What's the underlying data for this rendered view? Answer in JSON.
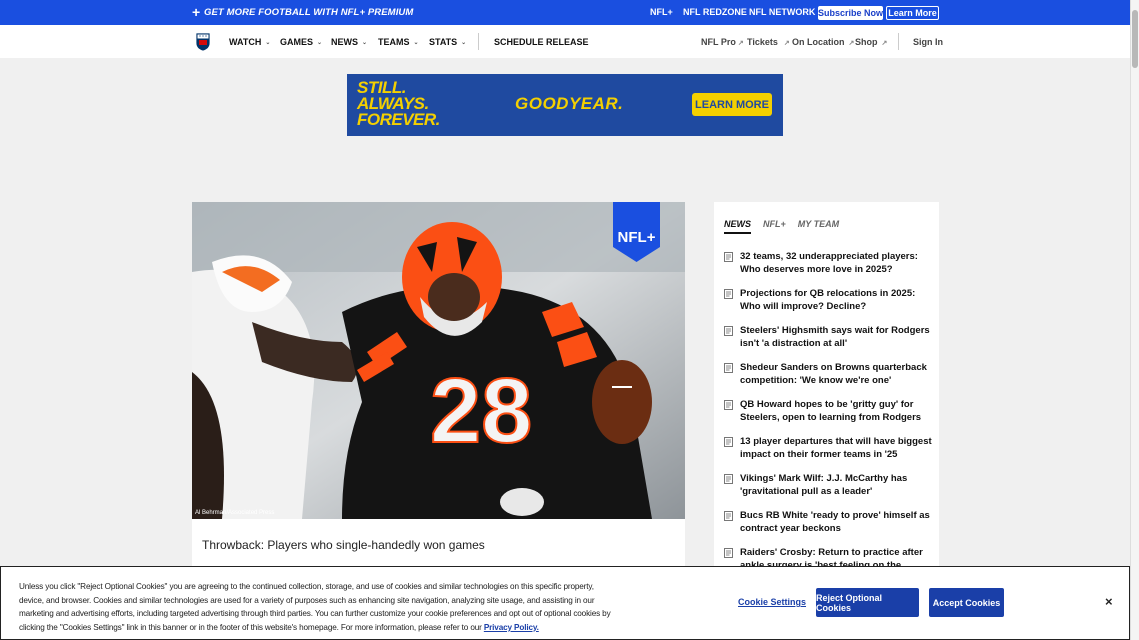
{
  "promo": {
    "plus_icon": "+",
    "text": "GET MORE FOOTBALL WITH NFL+ PREMIUM",
    "links": [
      "NFL+",
      "NFL REDZONE",
      "NFL NETWORK"
    ],
    "subscribe_label": "Subscribe Now",
    "learn_label": "Learn More",
    "color": "#1a4fe0"
  },
  "nav": {
    "logo_icon": "nfl-shield-icon",
    "items": [
      "WATCH",
      "GAMES",
      "NEWS",
      "TEAMS",
      "STATS"
    ],
    "caret": "⌄",
    "schedule": "SCHEDULE RELEASE",
    "right": [
      "NFL Pro",
      "Tickets",
      "On Location",
      "Shop"
    ],
    "ext_icon": "↗",
    "sign_in": "Sign In"
  },
  "ad": {
    "slogan": [
      "STILL.",
      "ALWAYS.",
      "FOREVER."
    ],
    "brand": "GOODYEAR.",
    "cta": "LEARN MORE",
    "bg": "#1f4aa0",
    "accent": "#f4d000"
  },
  "feature": {
    "photo_credit": "Al Behrman/Associated Press",
    "badge": "NFL+",
    "jersey_number": "28",
    "title": "Throwback: Players who single-handedly won games"
  },
  "sidebar": {
    "tabs": [
      "NEWS",
      "NFL+",
      "MY TEAM"
    ],
    "items": [
      "32 teams, 32 underappreciated players: Who deserves more love in 2025?",
      "Projections for QB relocations in 2025: Who will improve? Decline?",
      "Steelers' Highsmith says wait for Rodgers isn't 'a distraction at all'",
      "Shedeur Sanders on Browns quarterback competition: 'We know we're one'",
      "QB Howard hopes to be 'gritty guy' for Steelers, open to learning from Rodgers",
      "13 player departures that will have biggest impact on their former teams in '25",
      "Vikings' Mark Wilf: J.J. McCarthy has 'gravitational pull as a leader'",
      "Bucs RB White 'ready to prove' himself as contract year beckons",
      "Raiders' Crosby: Return to practice after ankle surgery is 'best feeling on the planet'"
    ]
  },
  "cookie": {
    "text": "Unless you click \"Reject Optional Cookies\" you are agreeing to the continued collection, storage, and use of cookies and similar technologies on this specific property, device, and browser. Cookies and similar technologies are used for a variety of purposes such as enhancing site navigation, analyzing site usage, and assisting in our marketing and advertising efforts, including targeted advertising through third parties. You can further customize your cookie preferences and opt out of optional cookies by clicking the \"Cookies Settings\" link in this banner or in the footer of this website's homepage. For more information, please refer to our ",
    "policy_link": "Privacy Policy.",
    "settings": "Cookie Settings",
    "reject": "Reject Optional Cookies",
    "accept": "Accept Cookies",
    "close": "×"
  }
}
